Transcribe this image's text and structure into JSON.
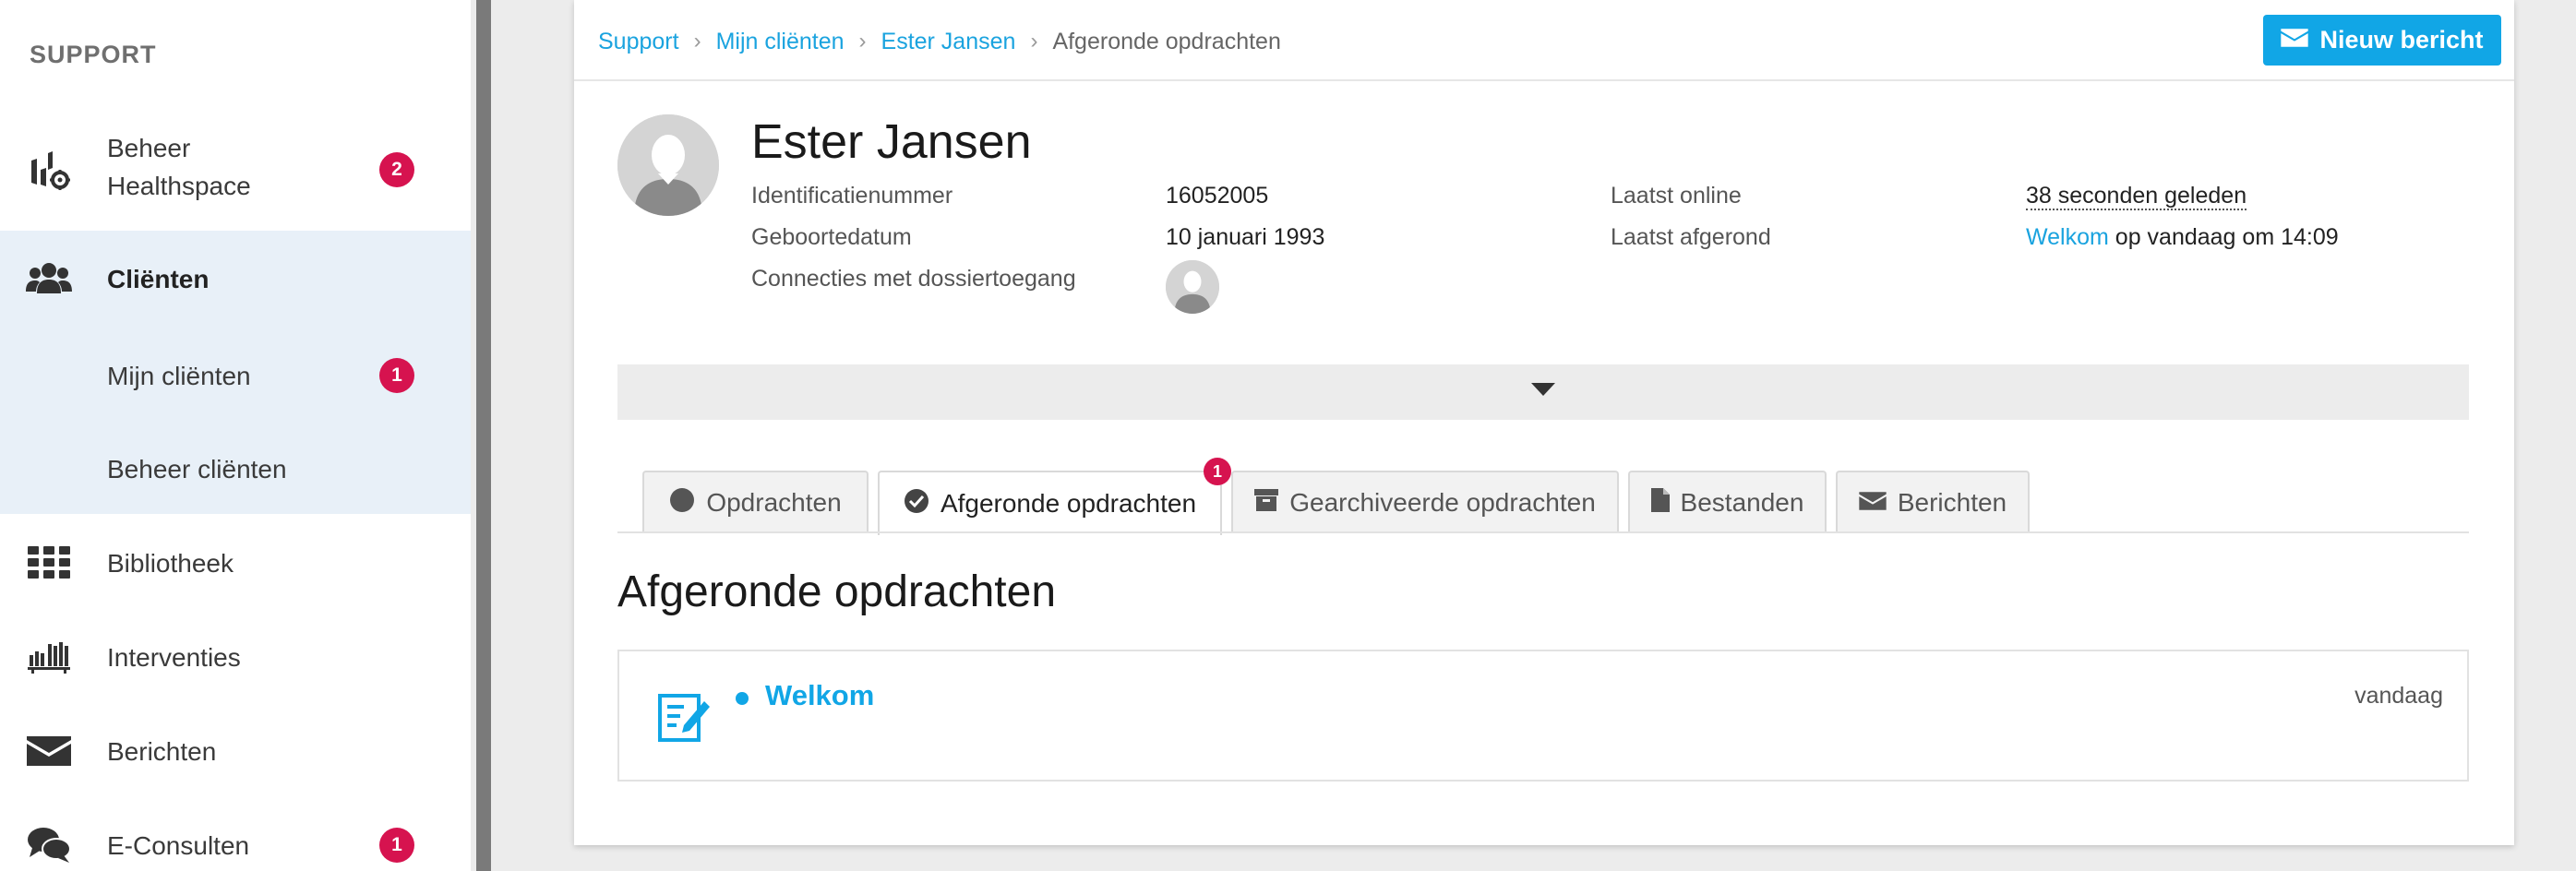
{
  "sidebar": {
    "heading": "SUPPORT",
    "items": [
      {
        "label": "Beheer\nHealthspace",
        "label_line1": "Beheer",
        "label_line2": "Healthspace",
        "icon": "healthspace-settings-icon",
        "badge": "2"
      },
      {
        "label": "Cliënten",
        "icon": "users-icon"
      },
      {
        "label": "Mijn cliënten",
        "badge": "1"
      },
      {
        "label": "Beheer cliënten"
      },
      {
        "label": "Bibliotheek",
        "icon": "grid-icon"
      },
      {
        "label": "Interventies",
        "icon": "bookshelf-icon"
      },
      {
        "label": "Berichten",
        "icon": "envelope-icon"
      },
      {
        "label": "E-Consulten",
        "icon": "chat-icon",
        "badge": "1"
      }
    ]
  },
  "breadcrumb": {
    "items": [
      "Support",
      "Mijn cliënten",
      "Ester Jansen"
    ],
    "current": "Afgeronde opdrachten"
  },
  "toolbar": {
    "new_message_label": "Nieuw bericht"
  },
  "client": {
    "name": "Ester Jansen",
    "id_label": "Identificatienummer",
    "id_value": "16052005",
    "dob_label": "Geboortedatum",
    "dob_value": "10 januari 1993",
    "connections_label": "Connecties met dossiertoegang",
    "last_online_label": "Laatst online",
    "last_online_value": "38 seconden geleden",
    "last_completed_label": "Laatst afgerond",
    "last_completed_link": "Welkom",
    "last_completed_suffix": " op vandaag om 14:09"
  },
  "tabs": [
    {
      "label": "Opdrachten",
      "icon": "circle-icon"
    },
    {
      "label": "Afgeronde opdrachten",
      "icon": "check-circle-icon",
      "badge": "1",
      "active": true
    },
    {
      "label": "Gearchiveerde opdrachten",
      "icon": "archive-icon"
    },
    {
      "label": "Bestanden",
      "icon": "file-icon"
    },
    {
      "label": "Berichten",
      "icon": "envelope-icon"
    }
  ],
  "section": {
    "title": "Afgeronde opdrachten"
  },
  "assignments": [
    {
      "title": "Welkom",
      "date": "vandaag",
      "icon": "edit-document-icon"
    }
  ],
  "colors": {
    "accent": "#11a6e6",
    "badge": "#d6134f",
    "active_group_bg": "#e8f0f8"
  }
}
